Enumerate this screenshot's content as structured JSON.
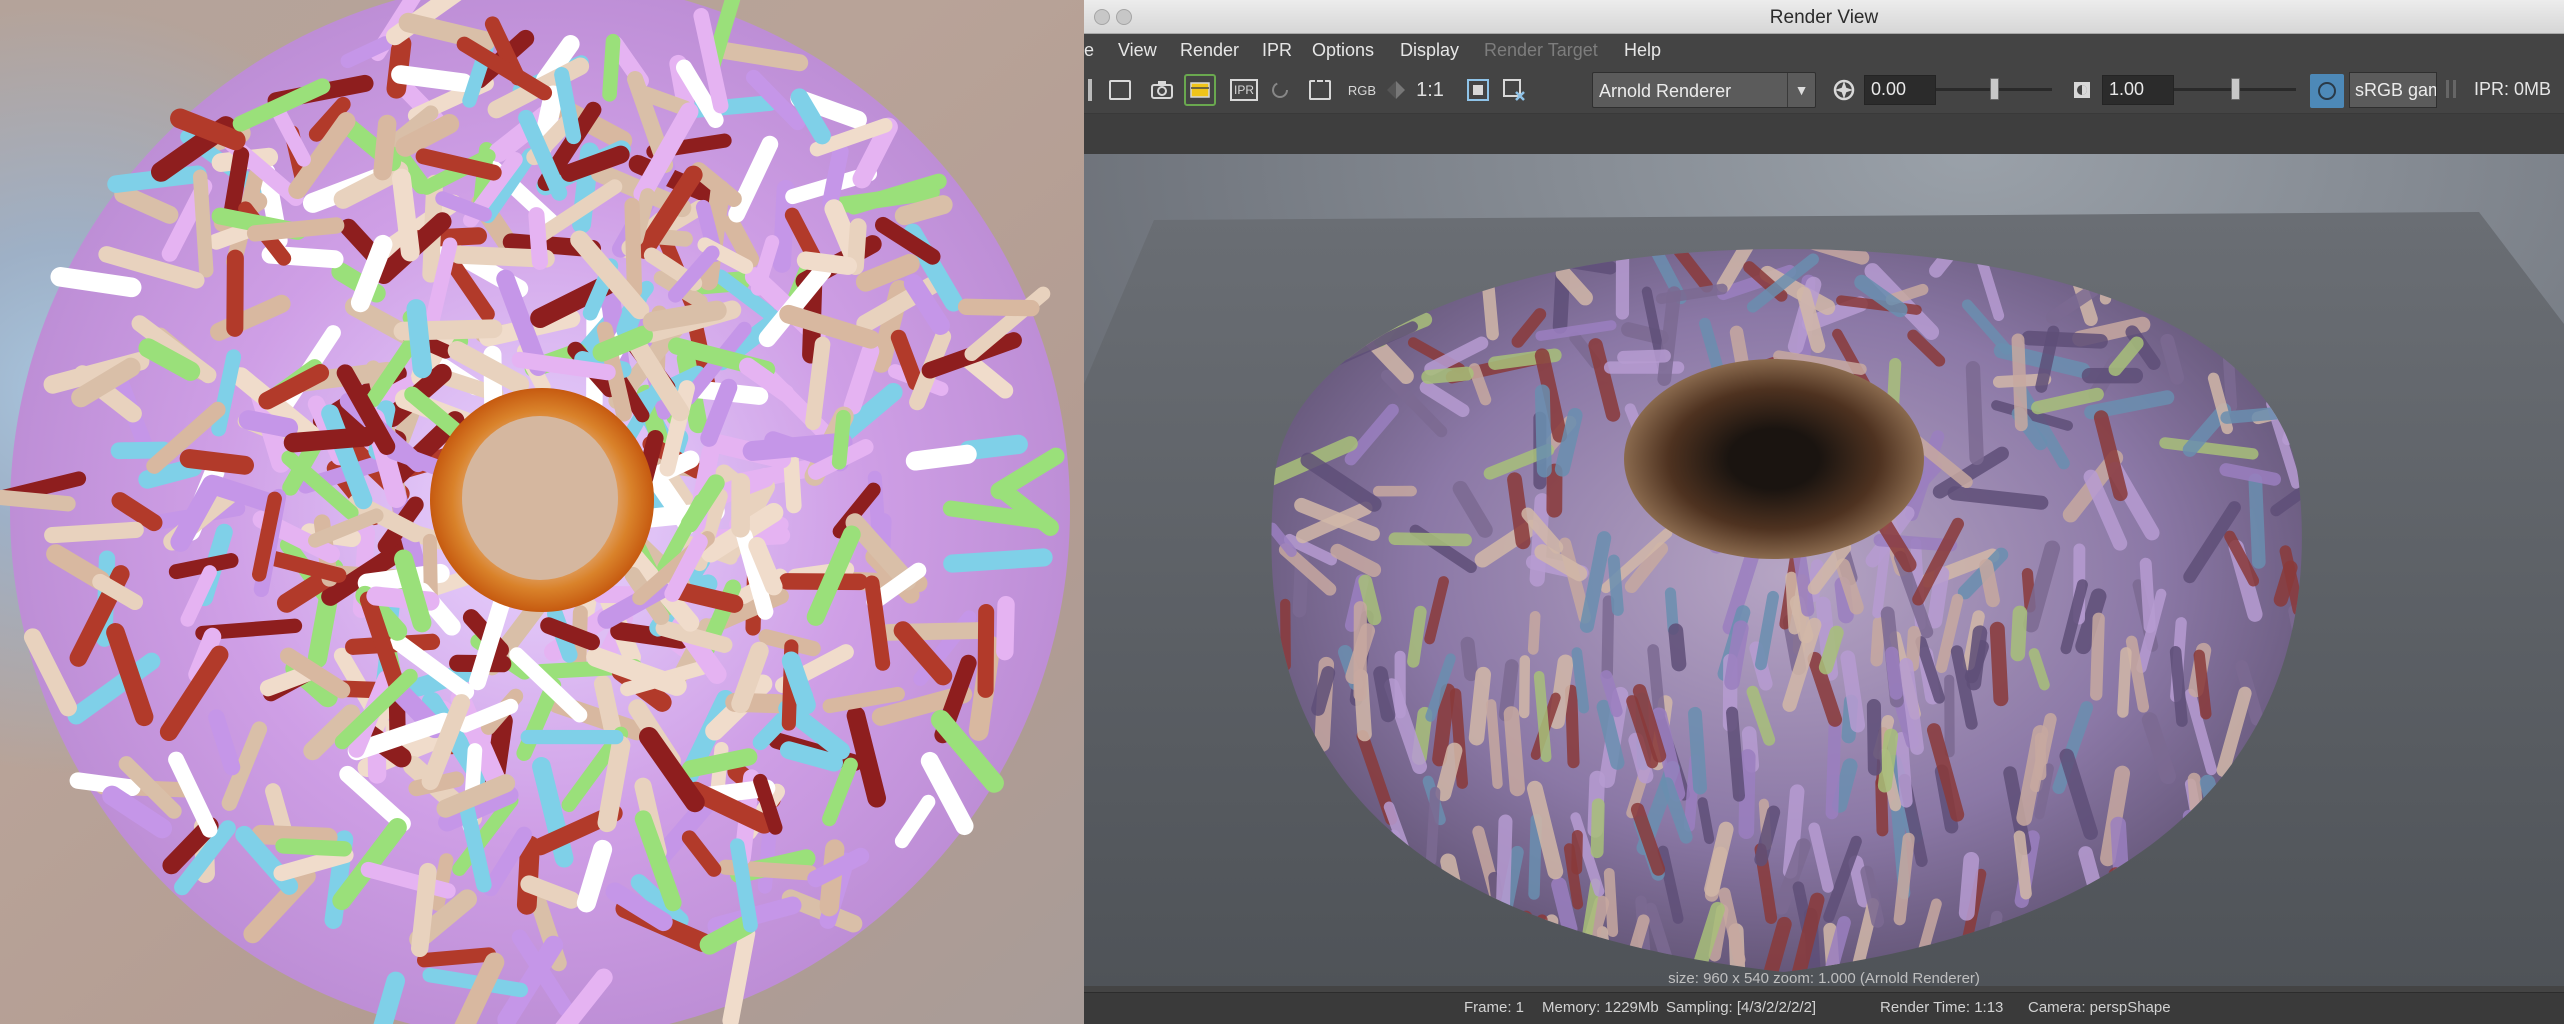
{
  "window": {
    "title": "Render View"
  },
  "menu": {
    "items": [
      {
        "label": "e",
        "enabled": true
      },
      {
        "label": "View",
        "enabled": true
      },
      {
        "label": "Render",
        "enabled": true
      },
      {
        "label": "IPR",
        "enabled": true
      },
      {
        "label": "Options",
        "enabled": true
      },
      {
        "label": "Display",
        "enabled": true
      },
      {
        "label": "Render Target",
        "enabled": false
      },
      {
        "label": "Help",
        "enabled": true
      }
    ]
  },
  "toolbar": {
    "rgb_label": "RGB",
    "ratio_label": "1:1",
    "ipr_label": "IPR",
    "renderer": "Arnold Renderer",
    "exposure": "0.00",
    "exposure_level": 0.5,
    "gamma": "1.00",
    "gamma_level": 0.5,
    "color_space": "sRGB gam",
    "ipr_memory": "IPR: 0MB",
    "icons": [
      "render-region-icon",
      "snapshot-camera-icon",
      "render-frame-icon",
      "ipr-render-icon",
      "refresh-icon",
      "render-sequence-icon",
      "rgb-channel-icon",
      "alpha-channel-icon",
      "ratio-icon",
      "keep-image-icon",
      "remove-image-icon",
      "exposure-icon",
      "gamma-icon",
      "color-management-icon"
    ]
  },
  "viewport": {
    "size_info": "size: 960 x 540  zoom: 1.000     (Arnold Renderer)"
  },
  "status": {
    "frame": "Frame: 1",
    "memory": "Memory: 1229Mb",
    "sampling": "Sampling: [4/3/2/2/2/2]",
    "render_time": "Render Time: 1:13",
    "camera": "Camera: perspShape"
  },
  "colors": {
    "menu_bg": "#444444",
    "field_bg": "#2b2b2b",
    "accent_green": "#6aa84f",
    "color_mgmt_blue": "#4d89b8"
  }
}
